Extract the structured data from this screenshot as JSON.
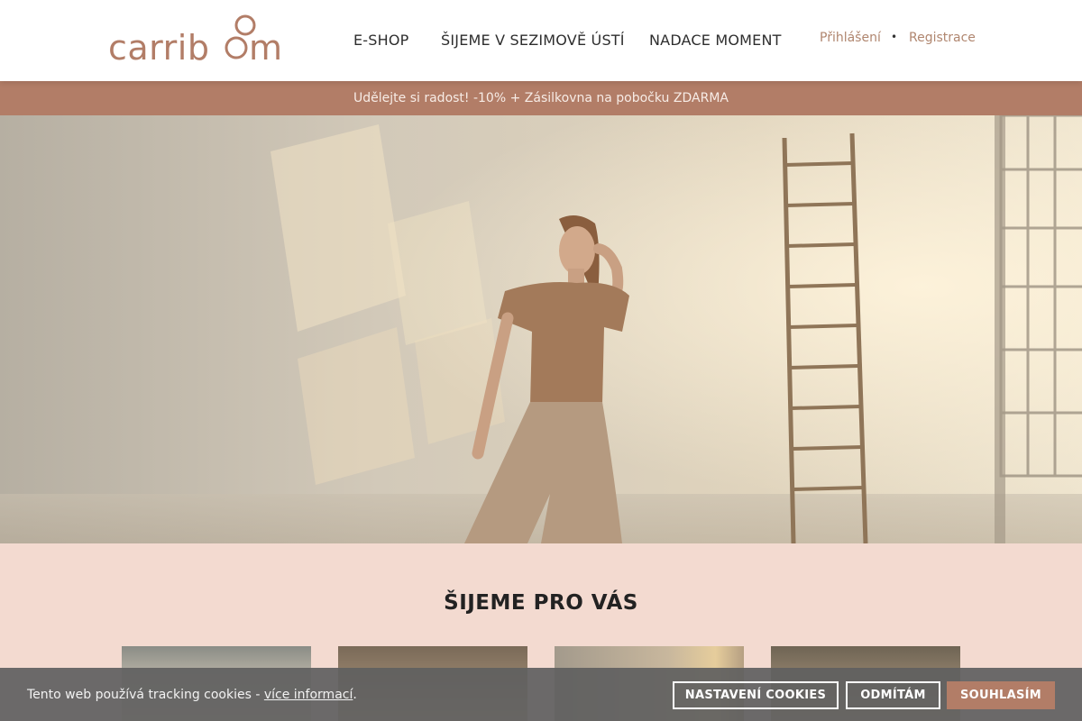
{
  "header": {
    "logo_text": "carriboom",
    "nav": [
      {
        "label": "E-SHOP"
      },
      {
        "label": "ŠIJEME V SEZIMOVĚ ÚSTÍ"
      },
      {
        "label": "NADACE MOMENT"
      }
    ],
    "login_label": "Přihlášení",
    "separator": "•",
    "register_label": "Registrace"
  },
  "promo": {
    "text": "Udělejte si radost! -10% + Zásilkovna na pobočku ZDARMA"
  },
  "section": {
    "title": "ŠIJEME PRO VÁS"
  },
  "cookie": {
    "text": "Tento web používá tracking cookies - ",
    "link": "více informací",
    "after": ".",
    "settings_label": "NASTAVENÍ COOKIES",
    "decline_label": "ODMÍTÁM",
    "accept_label": "SOUHLASÍM"
  },
  "colors": {
    "brand": "#b27d67",
    "section_bg": "#f3dad0",
    "link": "#b0866f"
  }
}
